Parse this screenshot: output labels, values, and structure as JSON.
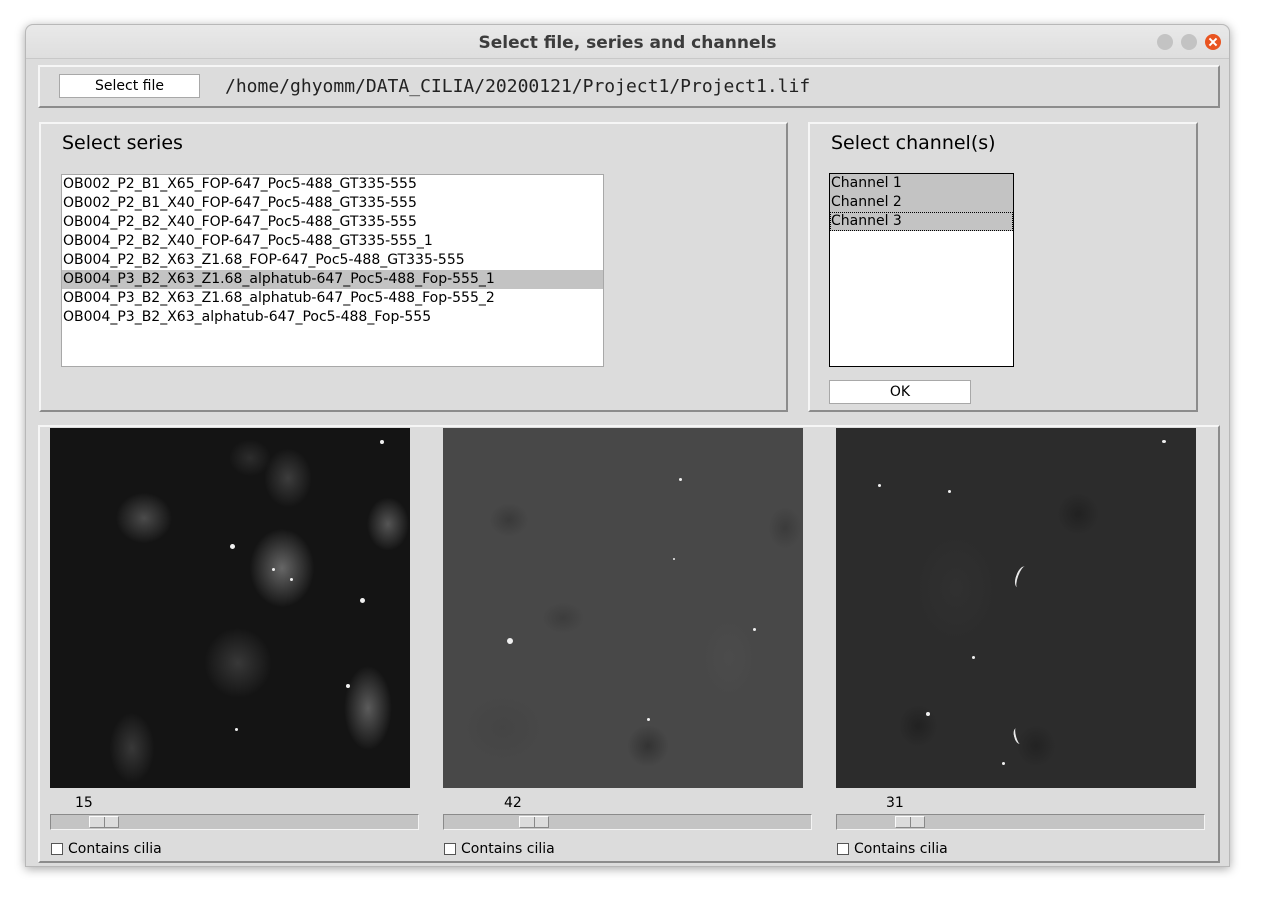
{
  "window": {
    "title": "Select file, series and channels"
  },
  "file_bar": {
    "select_file_label": "Select file",
    "path": "/home/ghyomm/DATA_CILIA/20200121/Project1/Project1.lif"
  },
  "series": {
    "heading": "Select series",
    "items": [
      "OB002_P2_B1_X65_FOP-647_Poc5-488_GT335-555",
      "OB002_P2_B1_X40_FOP-647_Poc5-488_GT335-555",
      "OB004_P2_B2_X40_FOP-647_Poc5-488_GT335-555",
      "OB004_P2_B2_X40_FOP-647_Poc5-488_GT335-555_1",
      "OB004_P2_B2_X63_Z1.68_FOP-647_Poc5-488_GT335-555",
      "OB004_P3_B2_X63_Z1.68_alphatub-647_Poc5-488_Fop-555_1",
      "OB004_P3_B2_X63_Z1.68_alphatub-647_Poc5-488_Fop-555_2",
      "OB004_P3_B2_X63_alphatub-647_Poc5-488_Fop-555"
    ],
    "selected_index": 5
  },
  "channels": {
    "heading": "Select channel(s)",
    "items": [
      "Channel 1",
      "Channel 2",
      "Channel 3"
    ],
    "selected": [
      0,
      1,
      2
    ],
    "ok_label": "OK"
  },
  "viewers": [
    {
      "slider_value": "15",
      "slider_fraction": 0.06,
      "checkbox_label": "Contains cilia",
      "checked": false
    },
    {
      "slider_value": "42",
      "slider_fraction": 0.17,
      "checkbox_label": "Contains cilia",
      "checked": false
    },
    {
      "slider_value": "31",
      "slider_fraction": 0.12,
      "checkbox_label": "Contains cilia",
      "checked": false
    }
  ],
  "colors": {
    "close_button": "#e95420",
    "selection": "#c3c3c3",
    "window_bg": "#dcdcdc"
  }
}
